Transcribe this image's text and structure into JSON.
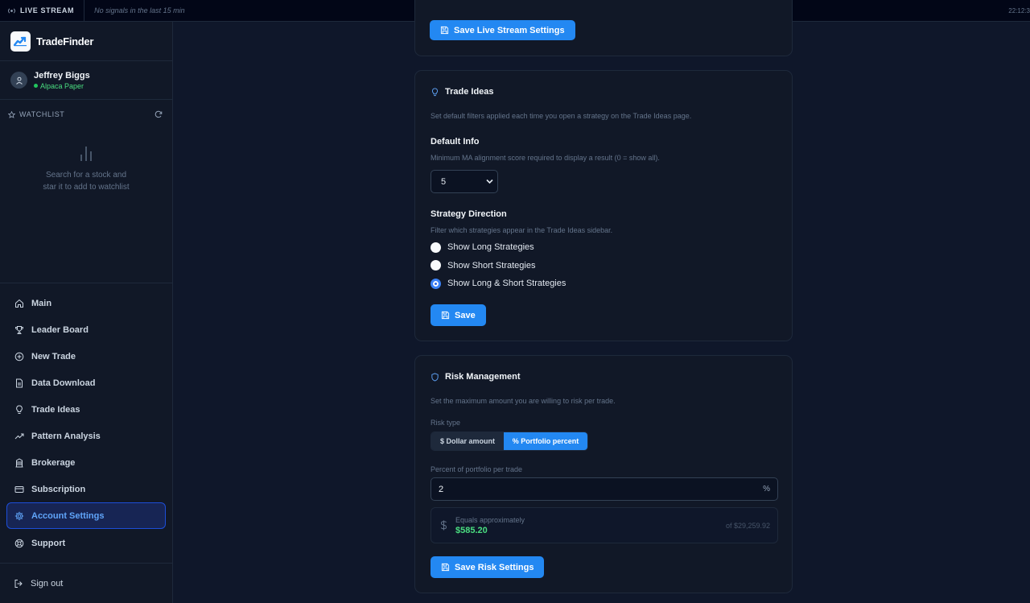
{
  "topbar": {
    "live_label": "LIVE STREAM",
    "status": "No signals in the last 15 min",
    "clock": "22:12:3"
  },
  "brand": {
    "name": "TradeFinder"
  },
  "user": {
    "name": "Jeffrey Biggs",
    "broker": "Alpaca Paper"
  },
  "watchlist": {
    "title": "WATCHLIST",
    "empty_line1": "Search for a stock and",
    "empty_line2": "star it to add to watchlist"
  },
  "nav": {
    "items": [
      {
        "label": "Main",
        "icon": "home-icon"
      },
      {
        "label": "Leader Board",
        "icon": "trophy-icon"
      },
      {
        "label": "New Trade",
        "icon": "plus-circle-icon"
      },
      {
        "label": "Data Download",
        "icon": "file-icon"
      },
      {
        "label": "Trade Ideas",
        "icon": "lightbulb-icon"
      },
      {
        "label": "Pattern Analysis",
        "icon": "trending-icon"
      },
      {
        "label": "Brokerage",
        "icon": "bank-icon"
      },
      {
        "label": "Subscription",
        "icon": "card-icon"
      },
      {
        "label": "Account Settings",
        "icon": "gear-icon",
        "active": true
      },
      {
        "label": "Support",
        "icon": "lifebuoy-icon"
      }
    ],
    "signout": "Sign out"
  },
  "live_stream_card": {
    "save_label": "Save Live Stream Settings"
  },
  "trade_ideas": {
    "title": "Trade Ideas",
    "description": "Set default filters applied each time you open a strategy on the Trade Ideas page.",
    "default_info_title": "Default Info",
    "default_info_desc": "Minimum MA alignment score required to display a result (0 = show all).",
    "score_value": "5",
    "direction_title": "Strategy Direction",
    "direction_desc": "Filter which strategies appear in the Trade Ideas sidebar.",
    "options": [
      {
        "label": "Show Long Strategies",
        "selected": false
      },
      {
        "label": "Show Short Strategies",
        "selected": false
      },
      {
        "label": "Show Long & Short Strategies",
        "selected": true
      }
    ],
    "save_label": "Save"
  },
  "risk": {
    "title": "Risk Management",
    "description": "Set the maximum amount you are willing to risk per trade.",
    "risk_type_label": "Risk type",
    "dollar_label": "$ Dollar amount",
    "percent_label": "% Portfolio percent",
    "selected_type": "percent",
    "portion_label": "Percent of portfolio per trade",
    "percent_value": "2",
    "percent_suffix": "%",
    "equals_label": "Equals approximately",
    "equals_value": "$585.20",
    "portfolio_total": "of $29,259.92",
    "save_label": "Save Risk Settings"
  },
  "colors": {
    "accent": "#2388f2",
    "positive": "#4ade80",
    "background": "#0f172a"
  }
}
